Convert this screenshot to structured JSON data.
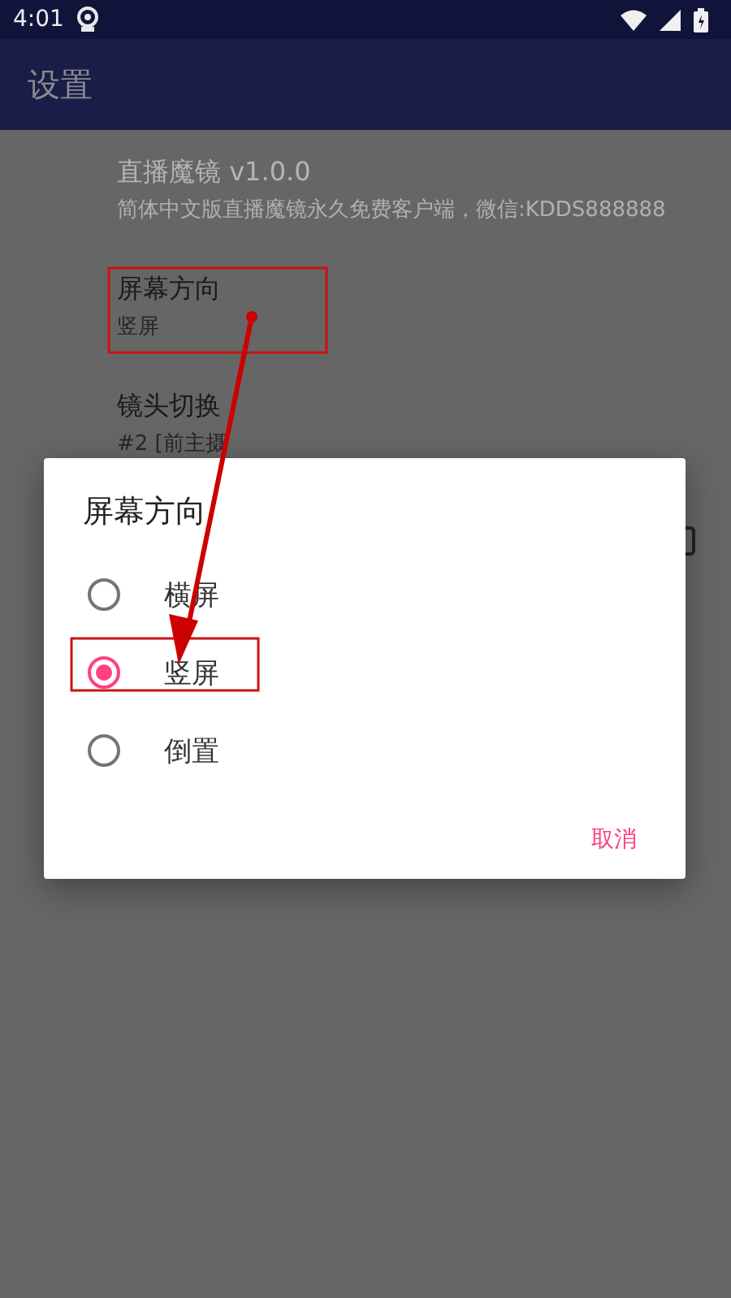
{
  "status_bar": {
    "time": "4:01"
  },
  "app_bar": {
    "title": "设置"
  },
  "preferences": [
    {
      "title": "直播魔镜 v1.0.0",
      "summary": "简体中文版直播魔镜永久免费客户端，微信:KDDS888888",
      "disabled": true
    },
    {
      "title": "屏幕方向",
      "summary": "竖屏",
      "disabled": false
    },
    {
      "title": "镜头切换",
      "summary": "#2 [前主摄",
      "disabled": false
    }
  ],
  "dialog": {
    "title": "屏幕方向",
    "options": [
      {
        "label": "横屏",
        "selected": false
      },
      {
        "label": "竖屏",
        "selected": true
      },
      {
        "label": "倒置",
        "selected": false
      }
    ],
    "buttons": [
      "取消"
    ]
  }
}
